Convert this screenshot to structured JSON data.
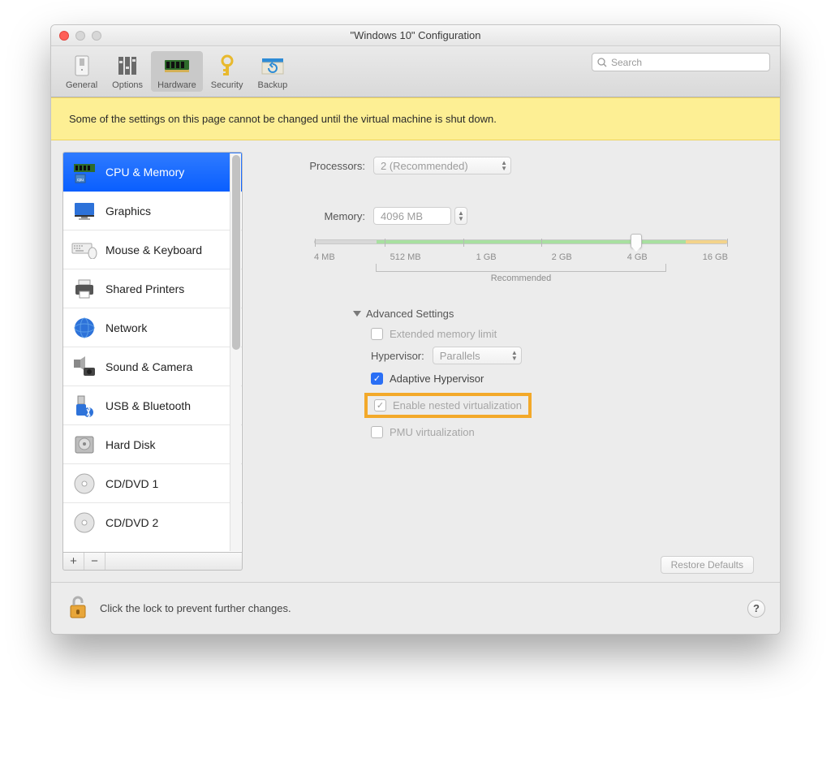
{
  "window": {
    "title": "\"Windows 10\" Configuration"
  },
  "toolbar": {
    "items": [
      {
        "label": "General"
      },
      {
        "label": "Options"
      },
      {
        "label": "Hardware"
      },
      {
        "label": "Security"
      },
      {
        "label": "Backup"
      }
    ],
    "search_placeholder": "Search"
  },
  "warning": "Some of the settings on this page cannot be changed until the virtual machine is shut down.",
  "sidebar": {
    "items": [
      {
        "label": "CPU & Memory"
      },
      {
        "label": "Graphics"
      },
      {
        "label": "Mouse & Keyboard"
      },
      {
        "label": "Shared Printers"
      },
      {
        "label": "Network"
      },
      {
        "label": "Sound & Camera"
      },
      {
        "label": "USB & Bluetooth"
      },
      {
        "label": "Hard Disk"
      },
      {
        "label": "CD/DVD 1"
      },
      {
        "label": "CD/DVD 2"
      }
    ],
    "add": "+",
    "remove": "−"
  },
  "cpu": {
    "processors_label": "Processors:",
    "processors_value": "2 (Recommended)",
    "memory_label": "Memory:",
    "memory_value": "4096 MB",
    "slider": {
      "ticks": [
        "4 MB",
        "512 MB",
        "1 GB",
        "2 GB",
        "4 GB",
        "16 GB"
      ],
      "recommended": "Recommended"
    },
    "advanced": {
      "header": "Advanced Settings",
      "extended_memory": "Extended memory limit",
      "hypervisor_label": "Hypervisor:",
      "hypervisor_value": "Parallels",
      "adaptive": "Adaptive Hypervisor",
      "nested": "Enable nested virtualization",
      "pmu": "PMU virtualization"
    },
    "restore": "Restore Defaults"
  },
  "footer": {
    "lock_text": "Click the lock to prevent further changes.",
    "help": "?"
  }
}
